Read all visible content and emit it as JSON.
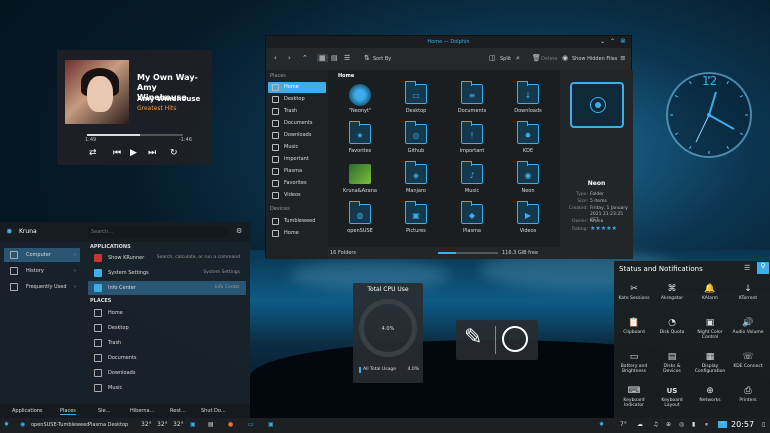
{
  "player": {
    "title": "My Own Way-Amy Winehouse",
    "artist": "Amy Winehouse",
    "album": "Greatest Hits",
    "elapsed": "1:49",
    "remaining": "-1:46",
    "progress": 0.55
  },
  "filemanager": {
    "window_title": "Home — Dolphin",
    "toolbar": {
      "sort": "Sort By",
      "split": "Split",
      "delete": "Delete",
      "hidden": "Show Hidden Files"
    },
    "places_header": "Places",
    "places": [
      "Home",
      "Desktop",
      "Trash",
      "Documents",
      "Downloads",
      "Music",
      "Important",
      "Plasma",
      "Favorites",
      "Videos"
    ],
    "devices_header": "Devices",
    "devices": [
      "Tumbleweed",
      "Home"
    ],
    "breadcrumb": "Home",
    "items": [
      "\"Neonyt\"",
      "Desktop",
      "Documents",
      "Downloads",
      "Favorites",
      "Github",
      "Important",
      "KDE",
      "Kruna&Azana",
      "Manjaro",
      "Music",
      "Neon",
      "openSUSE",
      "Pictures",
      "Plasma",
      "Videos"
    ],
    "status_left": "16 Folders",
    "status_right": "116.3 GiB free",
    "info": {
      "name": "Neon",
      "type_k": "Type:",
      "type_v": "Folder",
      "size_k": "Size:",
      "size_v": "5 items",
      "created_k": "Created:",
      "created_v": "Friday, 1 January 2021 21:23:25 CET",
      "owner_k": "Owner:",
      "owner_v": "Kruna",
      "rating_k": "Rating:",
      "rating_v": "★★★★★"
    }
  },
  "clock": {
    "twelve": "12"
  },
  "appmenu": {
    "user": "Kruna",
    "search_placeholder": "Search...",
    "categories": [
      "Computer",
      "History",
      "Frequently Used"
    ],
    "applications_header": "Applications",
    "apps": [
      {
        "name": "Show KRunner",
        "desc": "Search, calculate, or run a command"
      },
      {
        "name": "System Settings",
        "desc": "System Settings"
      },
      {
        "name": "Info Center",
        "desc": "Info Center"
      }
    ],
    "places_header": "Places",
    "places": [
      "Home",
      "Desktop",
      "Trash",
      "Documents",
      "Downloads",
      "Music"
    ],
    "footer": [
      "Applications",
      "Places",
      "Sle...",
      "Hiberna...",
      "Rest...",
      "Shut Do..."
    ]
  },
  "cpu": {
    "title": "Total CPU Use",
    "value": "4.0%",
    "legend": "All Total Usage",
    "legend_value": "4.0%"
  },
  "notifications": {
    "title": "Status and Notifications",
    "items": [
      {
        "label": "Kate Sessions",
        "icon": "kate-icon"
      },
      {
        "label": "Akregator",
        "icon": "rss-icon"
      },
      {
        "label": "KAlarm",
        "icon": "bell-icon"
      },
      {
        "label": "KTorrent",
        "icon": "download-icon"
      },
      {
        "label": "Clipboard",
        "icon": "clipboard-icon"
      },
      {
        "label": "Disk Quota",
        "icon": "disk-icon"
      },
      {
        "label": "Night Color Control",
        "icon": "monitor-icon"
      },
      {
        "label": "Audio Volume",
        "icon": "speaker-icon"
      },
      {
        "label": "Battery and Brightness",
        "icon": "battery-icon"
      },
      {
        "label": "Disks & Devices",
        "icon": "drive-icon"
      },
      {
        "label": "Display Configuration",
        "icon": "display-icon"
      },
      {
        "label": "KDE Connect",
        "icon": "phone-icon"
      },
      {
        "label": "Keyboard Indicator",
        "icon": "keyboard-icon"
      },
      {
        "label": "Keyboard Layout",
        "icon": "us-icon",
        "glyph": "US"
      },
      {
        "label": "Networks",
        "icon": "wifi-icon"
      },
      {
        "label": "Printers",
        "icon": "printer-icon"
      }
    ]
  },
  "taskbar": {
    "task1": "openSUSE-Tumbleweed",
    "task2": "Plasma Desktop",
    "temp1": "32°",
    "temp2": "32°",
    "temp3": "32°",
    "weather": "7°",
    "time": "20:57"
  },
  "colors": {
    "accent": "#3daee9"
  }
}
